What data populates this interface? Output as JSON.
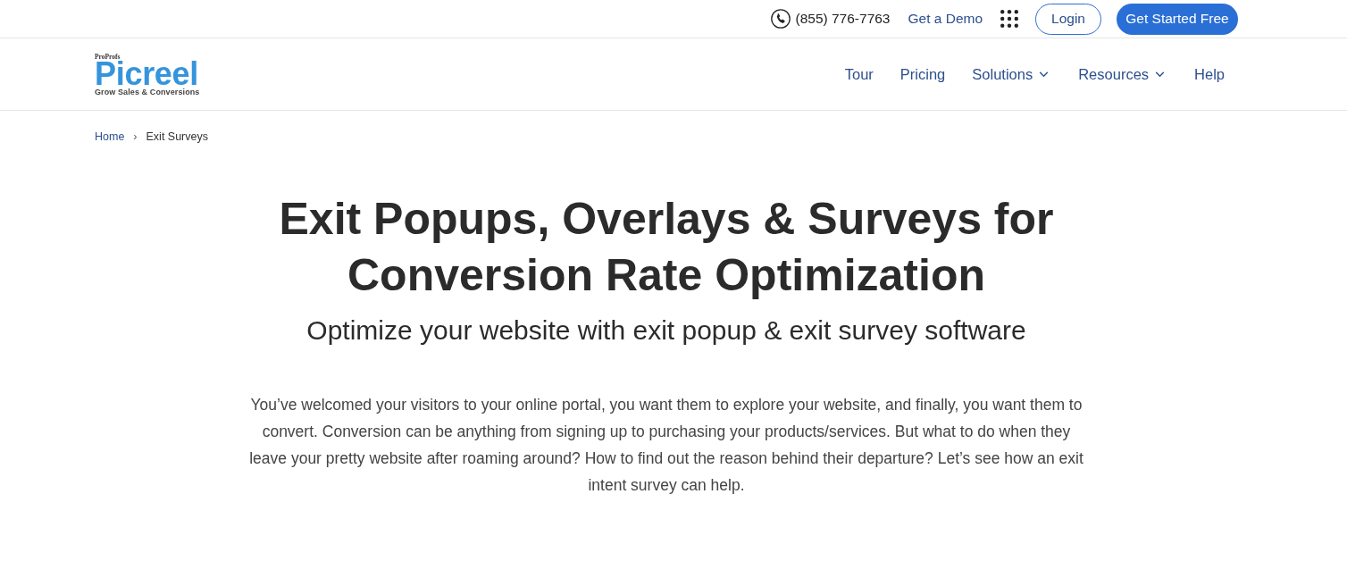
{
  "top_bar": {
    "phone": "(855) 776-7763",
    "demo_link": "Get a Demo",
    "login_button": "Login",
    "cta_button": "Get Started Free"
  },
  "header": {
    "logo": {
      "brand": "ProProfs",
      "name": "Picreel",
      "tagline": "Grow Sales & Conversions"
    },
    "nav": [
      {
        "label": "Tour",
        "dropdown": false
      },
      {
        "label": "Pricing",
        "dropdown": false
      },
      {
        "label": "Solutions",
        "dropdown": true
      },
      {
        "label": "Resources",
        "dropdown": true
      },
      {
        "label": "Help",
        "dropdown": false
      }
    ]
  },
  "breadcrumb": {
    "separator": "›",
    "items": [
      {
        "label": "Home",
        "kind": "link"
      },
      {
        "label": "Exit Surveys",
        "kind": "current"
      }
    ]
  },
  "hero": {
    "title": "Exit Popups, Overlays & Surveys for Conversion Rate Optimization",
    "subtitle": "Optimize your website with exit popup & exit survey software",
    "body": "You’ve welcomed your visitors to your online portal, you want them to explore your website, and finally, you want them to convert. Conversion can be anything from signing up to purchasing your products/services. But what to do when they leave your pretty website after roaming around? How to find out the reason behind their departure? Let’s see how an exit intent survey can help."
  }
}
